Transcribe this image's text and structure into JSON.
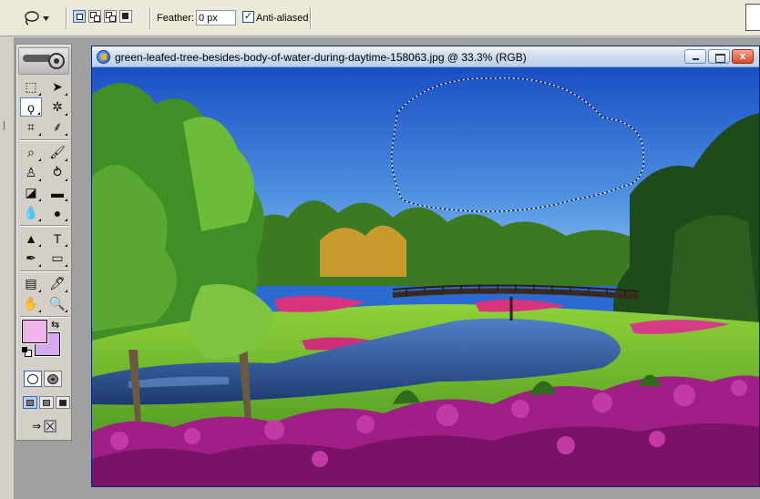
{
  "options_bar": {
    "feather_label": "Feather:",
    "feather_value": "0 px",
    "anti_aliased_label": "Anti-aliased",
    "anti_aliased_checked": true,
    "check_mark": "✓"
  },
  "document": {
    "title": "green-leafed-tree-besides-body-of-water-during-daytime-158063.jpg @ 33.3% (RGB)",
    "close_glyph": "x"
  },
  "toolbox": {
    "tools": [
      {
        "name": "rectangular-marquee-tool",
        "glyph": "⬚"
      },
      {
        "name": "move-tool",
        "glyph": "➤"
      },
      {
        "name": "lasso-tool",
        "glyph": "ϙ"
      },
      {
        "name": "magic-wand-tool",
        "glyph": "✲"
      },
      {
        "name": "crop-tool",
        "glyph": "⌗"
      },
      {
        "name": "slice-tool",
        "glyph": "⸙"
      },
      {
        "name": "healing-brush-tool",
        "glyph": "⌕"
      },
      {
        "name": "brush-tool",
        "glyph": "🖌"
      },
      {
        "name": "clone-stamp-tool",
        "glyph": "♙"
      },
      {
        "name": "history-brush-tool",
        "glyph": "⥁"
      },
      {
        "name": "eraser-tool",
        "glyph": "◪"
      },
      {
        "name": "gradient-tool",
        "glyph": "▬"
      },
      {
        "name": "blur-tool",
        "glyph": "💧"
      },
      {
        "name": "dodge-tool",
        "glyph": "●"
      },
      {
        "name": "path-selection-tool",
        "glyph": "▲"
      },
      {
        "name": "type-tool",
        "glyph": "T"
      },
      {
        "name": "pen-tool",
        "glyph": "✒"
      },
      {
        "name": "shape-tool",
        "glyph": "▭"
      },
      {
        "name": "notes-tool",
        "glyph": "▤"
      },
      {
        "name": "eyedropper-tool",
        "glyph": "🖊"
      },
      {
        "name": "hand-tool",
        "glyph": "✋"
      },
      {
        "name": "zoom-tool",
        "glyph": "🔍"
      }
    ],
    "selected_tool": "lasso-tool",
    "swap_glyph": "⇆",
    "imageready_glyph": "⇒",
    "foreground_color": "#f0b3ea",
    "background_color": "#d6a8ee"
  },
  "colors": {
    "sky_top": "#1a4fc4",
    "sky_bottom": "#8fc3ef",
    "grass": "#63b52a",
    "water": "#2a4f8c",
    "flowers": "#a01f86"
  }
}
